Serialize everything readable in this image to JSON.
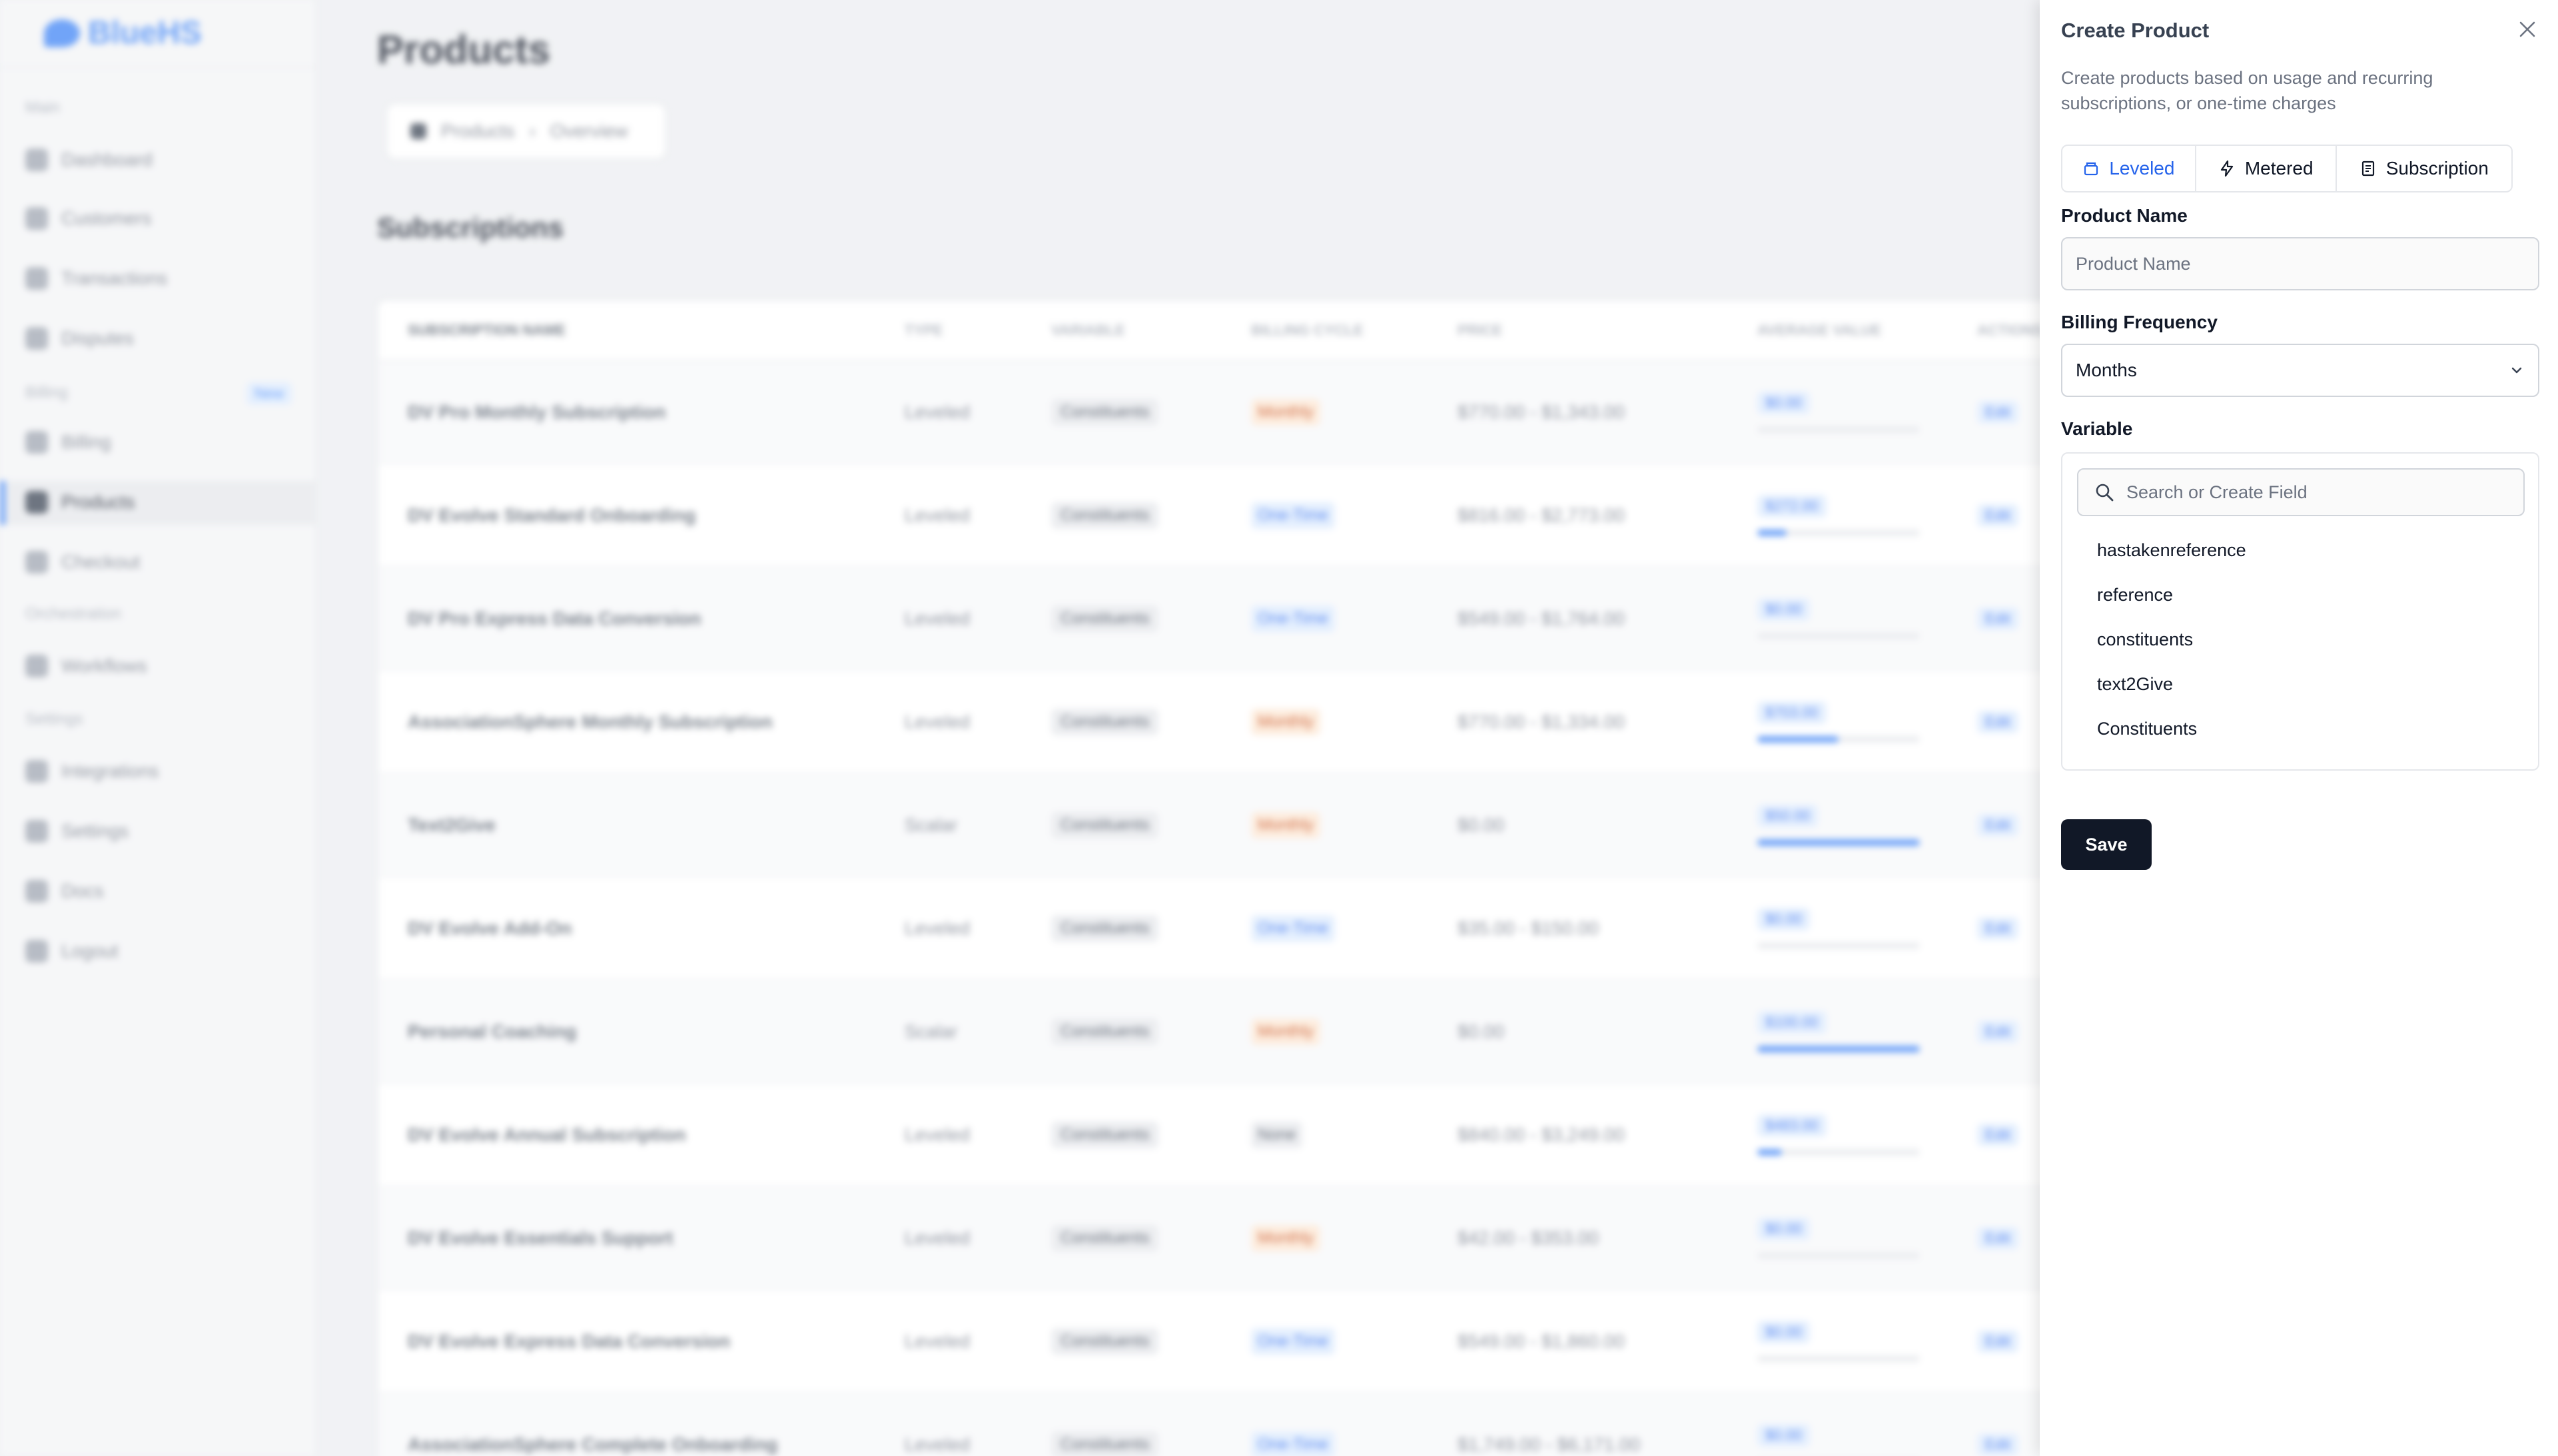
{
  "app": {
    "brand": "BlueHS",
    "sidebar": {
      "sections": {
        "main": "Main",
        "billing": "Billing",
        "orchestration": "Orchestration",
        "settings": "Settings"
      },
      "badge_new": "New",
      "items": [
        {
          "label": "Dashboard"
        },
        {
          "label": "Customers"
        },
        {
          "label": "Transactions"
        },
        {
          "label": "Disputes"
        },
        {
          "label": "Billing"
        },
        {
          "label": "Products"
        },
        {
          "label": "Checkout"
        },
        {
          "label": "Workflows"
        },
        {
          "label": "Integrations"
        },
        {
          "label": "Settings"
        },
        {
          "label": "Docs"
        },
        {
          "label": "Logout"
        }
      ]
    },
    "page_title": "Products",
    "breadcrumb": {
      "first": "Products",
      "second": "Overview"
    },
    "section_title": "Subscriptions",
    "table": {
      "headers": [
        "SUBSCRIPTION NAME",
        "TYPE",
        "VARIABLE",
        "BILLING CYCLE",
        "PRICE",
        "AVERAGE VALUE",
        "ACTIONS"
      ],
      "rows": [
        {
          "name": "DV Pro Monthly Subscription",
          "type": "Leveled",
          "variable": "Constituents",
          "cycle": "Monthly",
          "cycle_kind": "monthly",
          "price": "$770.00 - $1,343.00",
          "avg": "$0.00",
          "avg_pct": 0
        },
        {
          "name": "DV Evolve Standard Onboarding",
          "type": "Leveled",
          "variable": "Constituents",
          "cycle": "One-Time",
          "cycle_kind": "onetime",
          "price": "$816.00 - $2,773.00",
          "avg": "$272.00",
          "avg_pct": 18
        },
        {
          "name": "DV Pro Express Data Conversion",
          "type": "Leveled",
          "variable": "Constituents",
          "cycle": "One-Time",
          "cycle_kind": "onetime",
          "price": "$549.00 - $1,764.00",
          "avg": "$0.00",
          "avg_pct": 0
        },
        {
          "name": "AssociationSphere Monthly Subscription",
          "type": "Leveled",
          "variable": "Constituents",
          "cycle": "Monthly",
          "cycle_kind": "monthly",
          "price": "$770.00 - $1,334.00",
          "avg": "$703.00",
          "avg_pct": 50
        },
        {
          "name": "Text2Give",
          "type": "Scalar",
          "variable": "Constituents",
          "cycle": "Monthly",
          "cycle_kind": "monthly",
          "price": "$0.00",
          "avg": "$50.00",
          "avg_pct": 100
        },
        {
          "name": "DV Evolve Add-On",
          "type": "Leveled",
          "variable": "Constituents",
          "cycle": "One-Time",
          "cycle_kind": "onetime",
          "price": "$35.00 - $150.00",
          "avg": "$0.00",
          "avg_pct": 0
        },
        {
          "name": "Personal Coaching",
          "type": "Scalar",
          "variable": "Constituents",
          "cycle": "Monthly",
          "cycle_kind": "monthly",
          "price": "$0.00",
          "avg": "$100.00",
          "avg_pct": 100
        },
        {
          "name": "DV Evolve Annual Subscription",
          "type": "Leveled",
          "variable": "Constituents",
          "cycle": "None",
          "cycle_kind": "none",
          "price": "$840.00 - $3,249.00",
          "avg": "$483.00",
          "avg_pct": 15
        },
        {
          "name": "DV Evolve Essentials Support",
          "type": "Leveled",
          "variable": "Constituents",
          "cycle": "Monthly",
          "cycle_kind": "monthly",
          "price": "$42.00 - $353.00",
          "avg": "$0.00",
          "avg_pct": 0
        },
        {
          "name": "DV Evolve Express Data Conversion",
          "type": "Leveled",
          "variable": "Constituents",
          "cycle": "One-Time",
          "cycle_kind": "onetime",
          "price": "$549.00 - $1,860.00",
          "avg": "$0.00",
          "avg_pct": 0
        },
        {
          "name": "AssociationSphere Complete Onboarding",
          "type": "Leveled",
          "variable": "Constituents",
          "cycle": "One-Time",
          "cycle_kind": "onetime",
          "price": "$1,749.00 - $6,171.00",
          "avg": "$0.00",
          "avg_pct": 0
        }
      ]
    }
  },
  "drawer": {
    "title": "Create Product",
    "description": "Create products based on usage and recurring subscriptions, or one-time charges",
    "tabs": [
      {
        "label": "Leveled",
        "icon": "stack-icon",
        "active": true
      },
      {
        "label": "Metered",
        "icon": "lightning-icon",
        "active": false
      },
      {
        "label": "Subscription",
        "icon": "receipt-icon",
        "active": false
      }
    ],
    "product_name": {
      "label": "Product Name",
      "placeholder": "Product Name",
      "value": ""
    },
    "billing_frequency": {
      "label": "Billing Frequency",
      "value": "Months"
    },
    "variable": {
      "label": "Variable",
      "search_placeholder": "Search or Create Field",
      "options": [
        "hastakenreference",
        "reference",
        "constituents",
        "text2Give",
        "Constituents"
      ]
    },
    "save_label": "Save"
  },
  "colors": {
    "accent": "#2563eb",
    "primary_button": "#111827",
    "overlay": "#eceef1"
  }
}
